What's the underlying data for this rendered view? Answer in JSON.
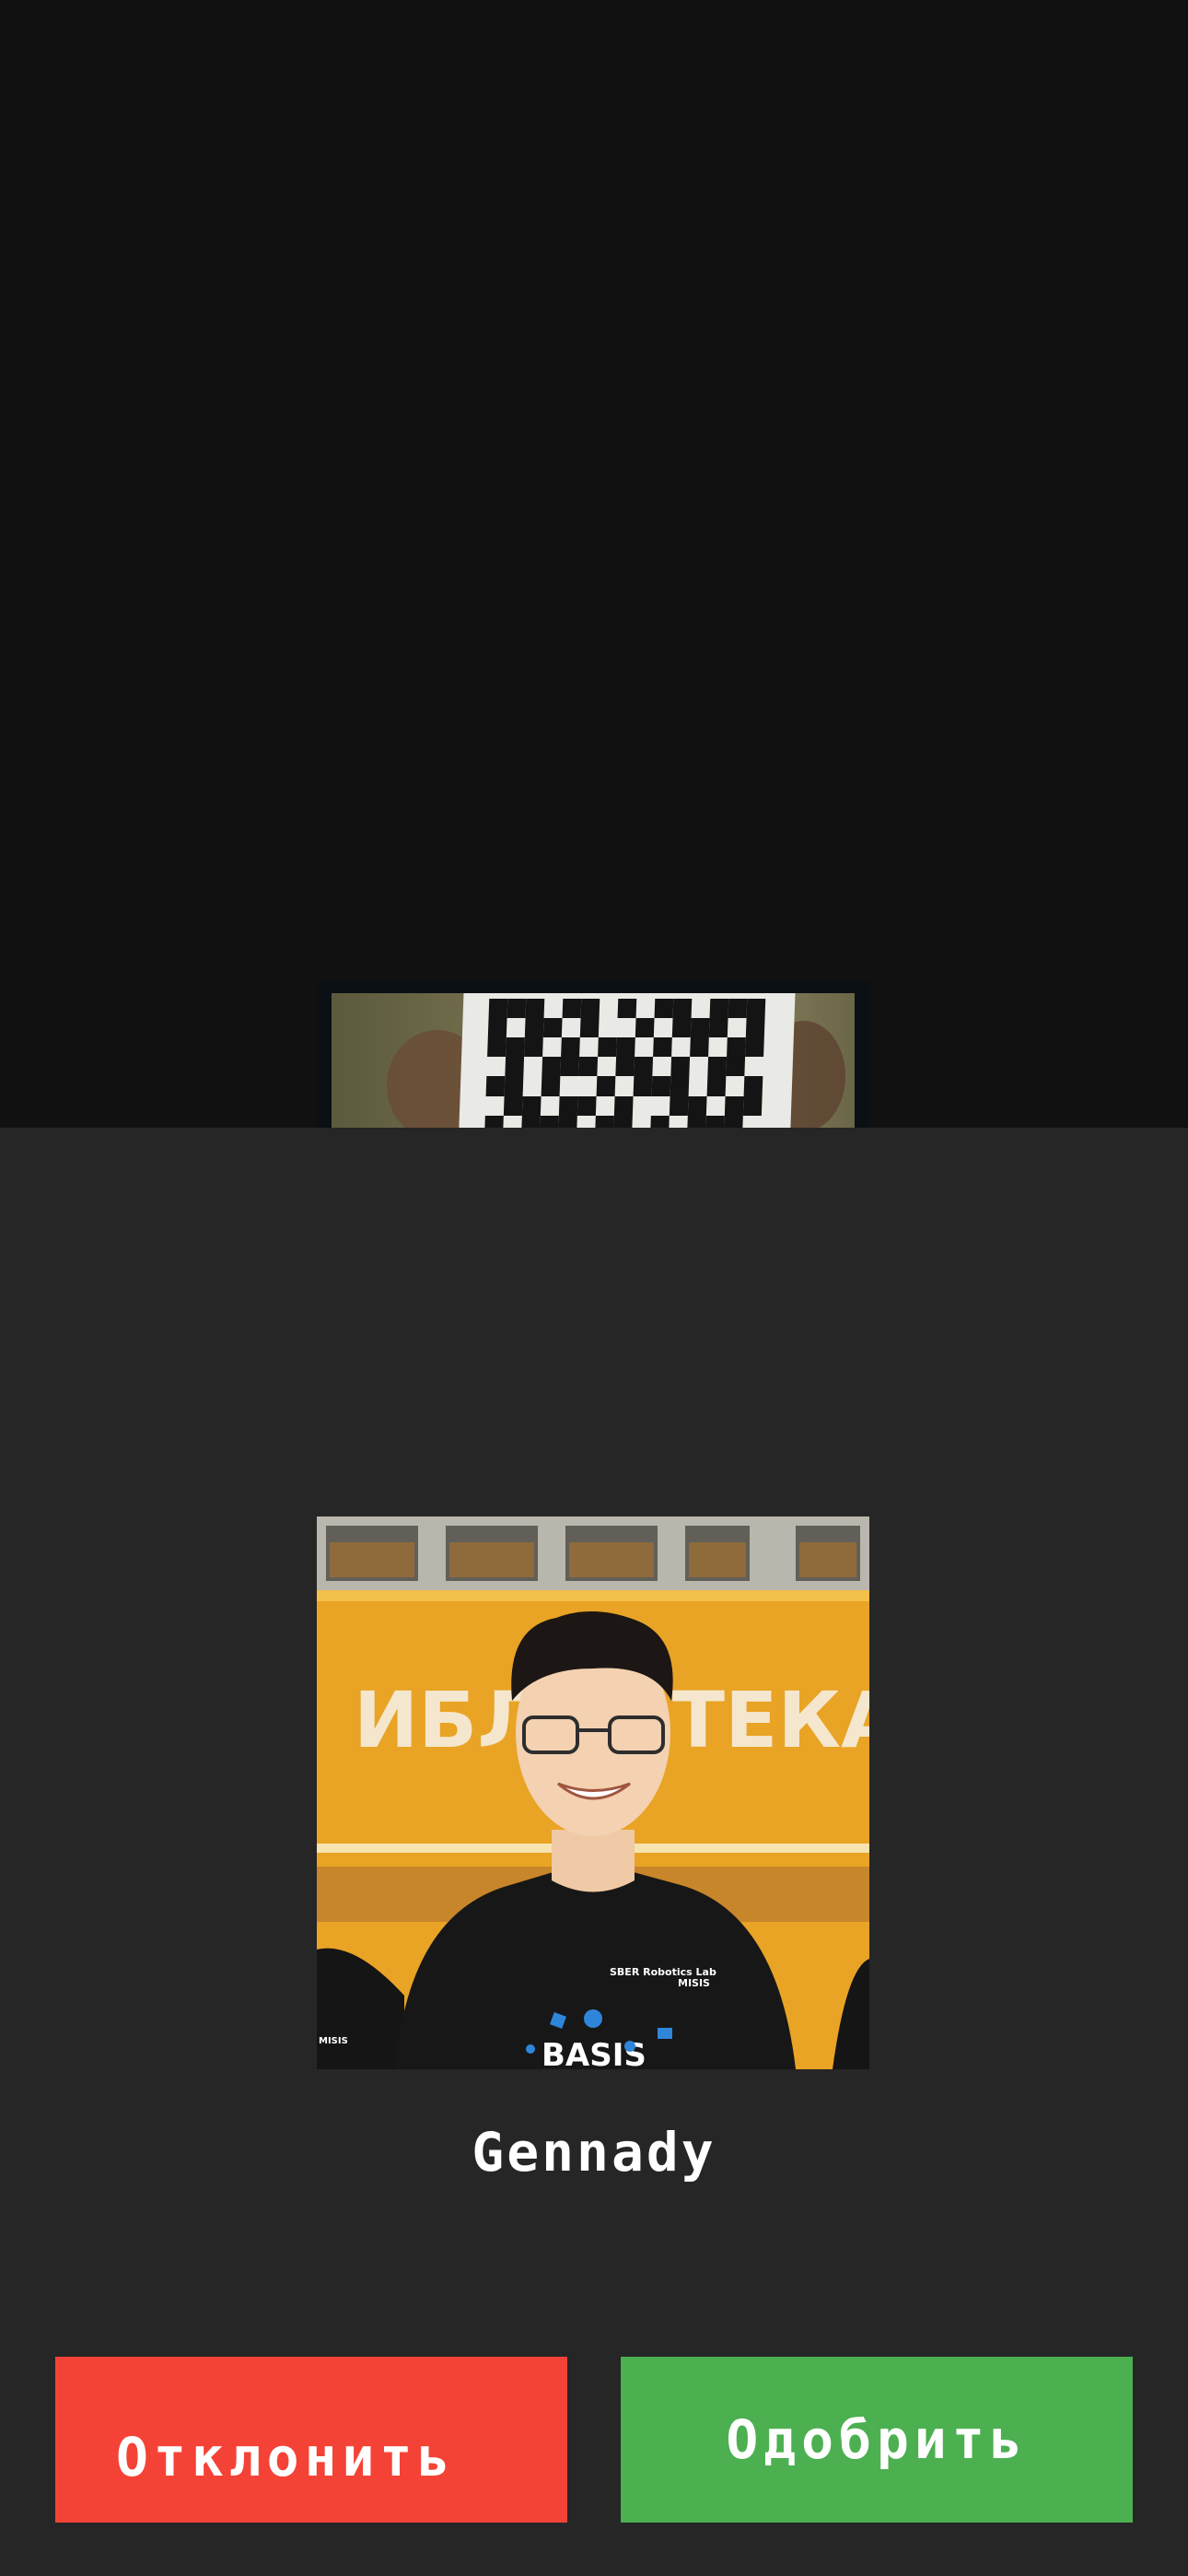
{
  "scanner": {
    "preview_icon": "qr-code-icon"
  },
  "profile": {
    "name": "Gennady",
    "photo_text": {
      "sign": "ИБЛИОТЕКА",
      "shirt_brand": "SBER Robotics Lab",
      "shirt_school": "MISIS",
      "shirt_logo": "BASIS"
    }
  },
  "actions": {
    "reject_label": "Отклонить",
    "approve_label": "Одобрить"
  },
  "colors": {
    "reject": "#f44336",
    "approve": "#4caf50",
    "sheet": "#262626",
    "background": "#111111"
  }
}
